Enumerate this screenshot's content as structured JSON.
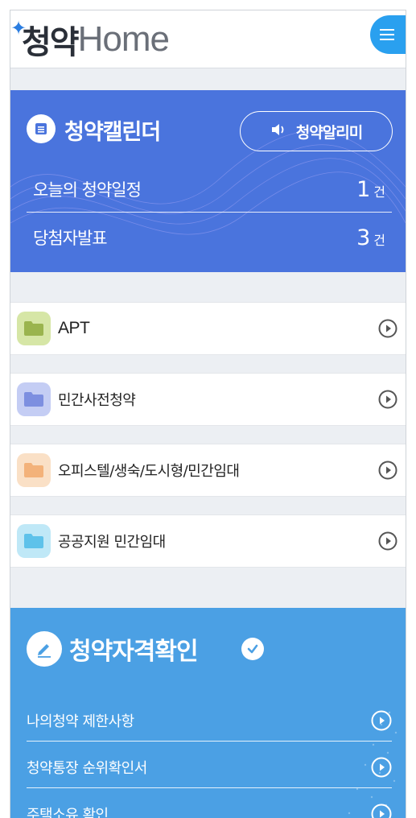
{
  "header": {
    "logo_kr": "청약",
    "logo_en": "Home",
    "menu_icon": "hamburger-icon"
  },
  "calendar": {
    "title": "청약캘린더",
    "icon": "calendar-icon",
    "alarm_button": "청약알리미",
    "alarm_icon": "speaker-icon",
    "rows": [
      {
        "label": "오늘의 청약일정",
        "count": "1",
        "unit": "건"
      },
      {
        "label": "당첨자발표",
        "count": "3",
        "unit": "건"
      }
    ],
    "bg_color": "#4a74dd"
  },
  "categories": [
    {
      "label": "APT",
      "icon": "folder-icon",
      "icon_bg": "#d6e6a6",
      "icon_fg": "#9ab44e"
    },
    {
      "label": "민간사전청약",
      "icon": "folder-icon",
      "icon_bg": "#c4cdf4",
      "icon_fg": "#7d8fe0"
    },
    {
      "label": "오피스텔/생숙/도시형/민간임대",
      "icon": "folder-icon",
      "icon_bg": "#fae0c6",
      "icon_fg": "#f3b27a"
    },
    {
      "label": "공공지원 민간임대",
      "icon": "folder-icon",
      "icon_bg": "#bfe8f7",
      "icon_fg": "#5ec2ea"
    }
  ],
  "eligibility": {
    "title": "청약자격확인",
    "icon": "pencil-icon",
    "check_icon": "check-circle-icon",
    "items": [
      {
        "label": "나의청약 제한사항"
      },
      {
        "label": "청약통장 순위확인서"
      },
      {
        "label": "주택소유 확인"
      }
    ],
    "bg_color": "#4ba0e4"
  }
}
